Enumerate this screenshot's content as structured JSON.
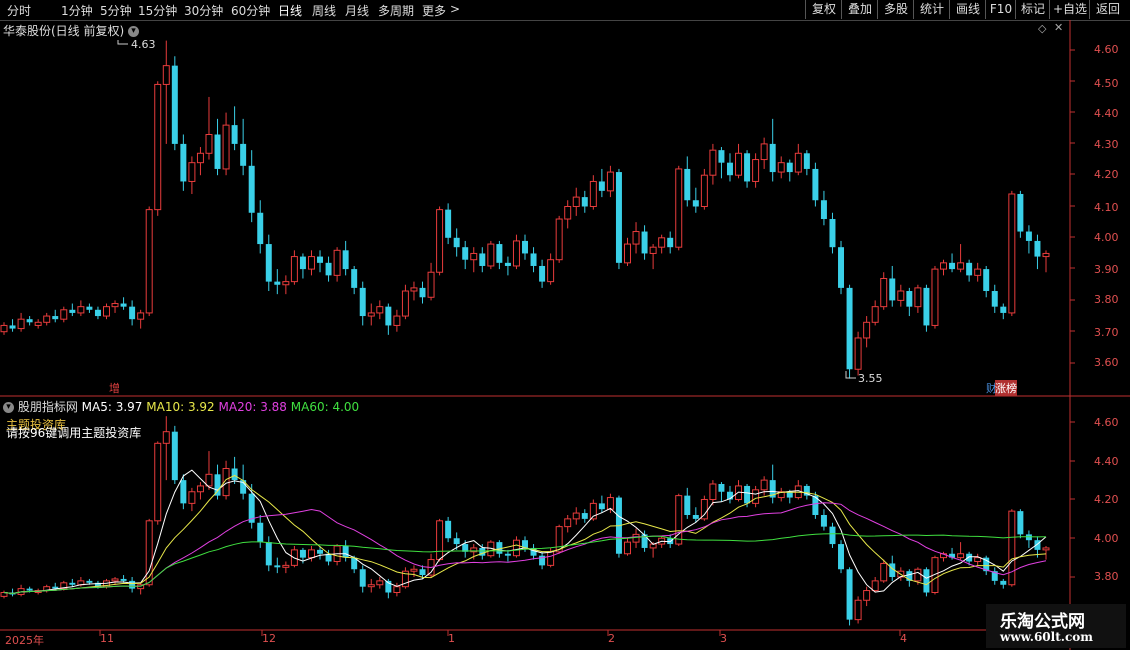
{
  "toolbar": {
    "periods": [
      "分时",
      "1分钟",
      "5分钟",
      "15分钟",
      "30分钟",
      "60分钟",
      "日线",
      "周线",
      "月线",
      "多周期",
      "更多"
    ],
    "active_period": "日线",
    "more_arrow": ">",
    "buttons": [
      "复权",
      "叠加",
      "多股",
      "统计",
      "画线",
      "F10",
      "标记",
      "+自选",
      "返回"
    ]
  },
  "main_panel": {
    "title": "华泰股份(日线 前复权)",
    "high_label": "4.63",
    "low_label": "3.55",
    "marker_left": "增",
    "marker_right_a": "财",
    "marker_right_b": "涨榜",
    "y_ticks": [
      "4.60",
      "4.50",
      "4.40",
      "4.30",
      "4.20",
      "4.10",
      "4.00",
      "3.90",
      "3.80",
      "3.70",
      "3.60"
    ]
  },
  "indicator_panel": {
    "name": "股朋指标网",
    "ma5_label": "MA5: 3.97",
    "ma10_label": "MA10: 3.92",
    "ma20_label": "MA20: 3.88",
    "ma60_label": "MA60: 4.00",
    "overlay_text_1": "主题投资库",
    "overlay_text_2": "请按96键调用主题投资库",
    "y_ticks": [
      "4.60",
      "4.40",
      "4.20",
      "4.00",
      "3.80"
    ]
  },
  "x_axis": {
    "labels": [
      "2025年",
      "11",
      "12",
      "1",
      "2",
      "3",
      "4"
    ]
  },
  "watermark": {
    "line1": "乐淘公式网",
    "line2": "www.60lt.com"
  },
  "colors": {
    "up": "#e83c3c",
    "down": "#3ad0e8",
    "ma5": "#ffffff",
    "ma10": "#e8e84a",
    "ma20": "#e040e0",
    "ma60": "#40e040",
    "axis": "#c03030"
  },
  "chart_data": {
    "type": "candlestick",
    "ylim_main": [
      3.52,
      4.68
    ],
    "ylim_indicator": [
      3.7,
      4.68
    ],
    "candles": [
      [
        3.7,
        3.73,
        3.69,
        3.72
      ],
      [
        3.72,
        3.74,
        3.7,
        3.71
      ],
      [
        3.71,
        3.76,
        3.7,
        3.74
      ],
      [
        3.74,
        3.75,
        3.72,
        3.73
      ],
      [
        3.72,
        3.74,
        3.71,
        3.73
      ],
      [
        3.73,
        3.76,
        3.72,
        3.75
      ],
      [
        3.75,
        3.77,
        3.73,
        3.74
      ],
      [
        3.74,
        3.78,
        3.73,
        3.77
      ],
      [
        3.77,
        3.79,
        3.75,
        3.76
      ],
      [
        3.76,
        3.8,
        3.75,
        3.78
      ],
      [
        3.78,
        3.79,
        3.76,
        3.77
      ],
      [
        3.77,
        3.78,
        3.74,
        3.75
      ],
      [
        3.75,
        3.79,
        3.74,
        3.78
      ],
      [
        3.78,
        3.8,
        3.76,
        3.79
      ],
      [
        3.79,
        3.81,
        3.77,
        3.78
      ],
      [
        3.78,
        3.8,
        3.72,
        3.74
      ],
      [
        3.74,
        3.77,
        3.71,
        3.76
      ],
      [
        3.76,
        4.1,
        3.75,
        4.09
      ],
      [
        4.09,
        4.5,
        4.07,
        4.49
      ],
      [
        4.49,
        4.63,
        4.3,
        4.55
      ],
      [
        4.55,
        4.58,
        4.28,
        4.3
      ],
      [
        4.3,
        4.33,
        4.15,
        4.18
      ],
      [
        4.18,
        4.26,
        4.14,
        4.24
      ],
      [
        4.24,
        4.29,
        4.2,
        4.27
      ],
      [
        4.27,
        4.45,
        4.25,
        4.33
      ],
      [
        4.33,
        4.38,
        4.2,
        4.22
      ],
      [
        4.22,
        4.4,
        4.2,
        4.36
      ],
      [
        4.36,
        4.42,
        4.28,
        4.3
      ],
      [
        4.3,
        4.38,
        4.2,
        4.23
      ],
      [
        4.23,
        4.28,
        4.05,
        4.08
      ],
      [
        4.08,
        4.12,
        3.95,
        3.98
      ],
      [
        3.98,
        4.01,
        3.83,
        3.86
      ],
      [
        3.86,
        3.9,
        3.82,
        3.85
      ],
      [
        3.85,
        3.88,
        3.82,
        3.86
      ],
      [
        3.86,
        3.96,
        3.85,
        3.94
      ],
      [
        3.94,
        3.95,
        3.87,
        3.9
      ],
      [
        3.9,
        3.96,
        3.88,
        3.94
      ],
      [
        3.94,
        3.96,
        3.89,
        3.92
      ],
      [
        3.92,
        3.94,
        3.86,
        3.88
      ],
      [
        3.88,
        3.97,
        3.86,
        3.96
      ],
      [
        3.96,
        3.99,
        3.88,
        3.9
      ],
      [
        3.9,
        3.91,
        3.82,
        3.84
      ],
      [
        3.84,
        3.86,
        3.72,
        3.75
      ],
      [
        3.75,
        3.79,
        3.72,
        3.76
      ],
      [
        3.76,
        3.8,
        3.74,
        3.78
      ],
      [
        3.78,
        3.79,
        3.69,
        3.72
      ],
      [
        3.72,
        3.77,
        3.7,
        3.75
      ],
      [
        3.75,
        3.85,
        3.74,
        3.83
      ],
      [
        3.83,
        3.86,
        3.8,
        3.84
      ],
      [
        3.84,
        3.86,
        3.79,
        3.81
      ],
      [
        3.81,
        3.92,
        3.8,
        3.89
      ],
      [
        3.89,
        4.1,
        3.88,
        4.09
      ],
      [
        4.09,
        4.11,
        3.98,
        4.0
      ],
      [
        4.0,
        4.03,
        3.94,
        3.97
      ],
      [
        3.97,
        3.99,
        3.9,
        3.93
      ],
      [
        3.93,
        3.97,
        3.89,
        3.95
      ],
      [
        3.95,
        3.97,
        3.89,
        3.91
      ],
      [
        3.91,
        3.99,
        3.9,
        3.98
      ],
      [
        3.98,
        3.99,
        3.9,
        3.92
      ],
      [
        3.92,
        3.94,
        3.88,
        3.91
      ],
      [
        3.91,
        4.01,
        3.9,
        3.99
      ],
      [
        3.99,
        4.01,
        3.93,
        3.95
      ],
      [
        3.95,
        3.97,
        3.89,
        3.91
      ],
      [
        3.91,
        3.93,
        3.84,
        3.86
      ],
      [
        3.86,
        3.95,
        3.85,
        3.93
      ],
      [
        3.93,
        4.07,
        3.92,
        4.06
      ],
      [
        4.06,
        4.12,
        4.03,
        4.1
      ],
      [
        4.1,
        4.16,
        4.07,
        4.13
      ],
      [
        4.13,
        4.15,
        4.08,
        4.1
      ],
      [
        4.1,
        4.2,
        4.09,
        4.18
      ],
      [
        4.18,
        4.22,
        4.13,
        4.15
      ],
      [
        4.15,
        4.23,
        4.13,
        4.21
      ],
      [
        4.21,
        4.22,
        3.9,
        3.92
      ],
      [
        3.92,
        4.0,
        3.91,
        3.98
      ],
      [
        3.98,
        4.05,
        3.95,
        4.02
      ],
      [
        4.02,
        4.04,
        3.93,
        3.95
      ],
      [
        3.95,
        3.98,
        3.9,
        3.97
      ],
      [
        3.97,
        4.01,
        3.95,
        4.0
      ],
      [
        4.0,
        4.02,
        3.95,
        3.97
      ],
      [
        3.97,
        4.23,
        3.96,
        4.22
      ],
      [
        4.22,
        4.26,
        4.1,
        4.12
      ],
      [
        4.12,
        4.16,
        4.08,
        4.1
      ],
      [
        4.1,
        4.22,
        4.09,
        4.2
      ],
      [
        4.2,
        4.3,
        4.17,
        4.28
      ],
      [
        4.28,
        4.29,
        4.19,
        4.24
      ],
      [
        4.24,
        4.27,
        4.18,
        4.2
      ],
      [
        4.2,
        4.3,
        4.19,
        4.27
      ],
      [
        4.27,
        4.28,
        4.16,
        4.18
      ],
      [
        4.18,
        4.27,
        4.16,
        4.25
      ],
      [
        4.25,
        4.32,
        4.22,
        4.3
      ],
      [
        4.3,
        4.38,
        4.18,
        4.21
      ],
      [
        4.21,
        4.26,
        4.19,
        4.24
      ],
      [
        4.24,
        4.25,
        4.18,
        4.21
      ],
      [
        4.21,
        4.3,
        4.2,
        4.27
      ],
      [
        4.27,
        4.28,
        4.2,
        4.22
      ],
      [
        4.22,
        4.24,
        4.1,
        4.12
      ],
      [
        4.12,
        4.15,
        4.04,
        4.06
      ],
      [
        4.06,
        4.08,
        3.95,
        3.97
      ],
      [
        3.97,
        3.99,
        3.82,
        3.84
      ],
      [
        3.84,
        3.85,
        3.55,
        3.58
      ],
      [
        3.58,
        3.7,
        3.56,
        3.68
      ],
      [
        3.68,
        3.75,
        3.65,
        3.73
      ],
      [
        3.73,
        3.8,
        3.72,
        3.78
      ],
      [
        3.78,
        3.89,
        3.77,
        3.87
      ],
      [
        3.87,
        3.91,
        3.78,
        3.8
      ],
      [
        3.8,
        3.85,
        3.78,
        3.83
      ],
      [
        3.83,
        3.84,
        3.75,
        3.78
      ],
      [
        3.78,
        3.85,
        3.76,
        3.84
      ],
      [
        3.84,
        3.85,
        3.7,
        3.72
      ],
      [
        3.72,
        3.91,
        3.71,
        3.9
      ],
      [
        3.9,
        3.93,
        3.88,
        3.92
      ],
      [
        3.92,
        3.95,
        3.89,
        3.9
      ],
      [
        3.9,
        3.98,
        3.89,
        3.92
      ],
      [
        3.92,
        3.93,
        3.86,
        3.88
      ],
      [
        3.88,
        3.92,
        3.86,
        3.9
      ],
      [
        3.9,
        3.91,
        3.81,
        3.83
      ],
      [
        3.83,
        3.85,
        3.76,
        3.78
      ],
      [
        3.78,
        3.79,
        3.74,
        3.76
      ],
      [
        3.76,
        4.15,
        3.75,
        4.14
      ],
      [
        4.14,
        4.15,
        4.0,
        4.02
      ],
      [
        4.02,
        4.04,
        3.95,
        3.99
      ],
      [
        3.99,
        4.01,
        3.9,
        3.94
      ],
      [
        3.94,
        3.96,
        3.89,
        3.95
      ]
    ]
  }
}
